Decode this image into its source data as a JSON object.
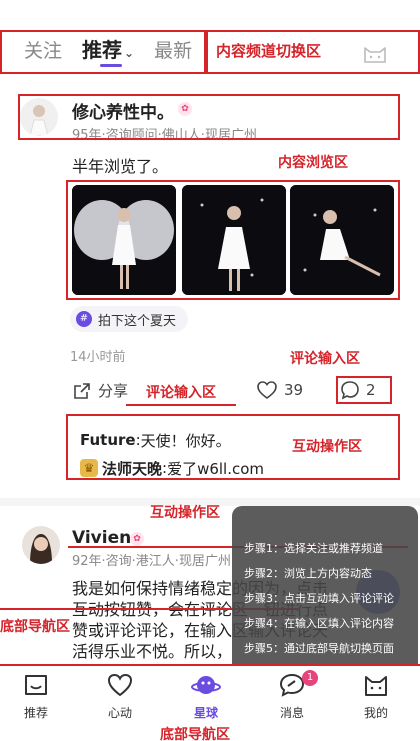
{
  "header": {
    "tabs": [
      {
        "label": "关注"
      },
      {
        "label": "推荐"
      },
      {
        "label": "最新"
      }
    ],
    "active_tab": "推荐"
  },
  "post1": {
    "author": "修心养性中。",
    "meta": "95年·咨询顾问·佛山人·现居广州",
    "text": "半年浏览了。",
    "topic": "拍下这个夏天",
    "time": "14小时前",
    "share_label": "分享",
    "like_count": "39",
    "comment_count": "2",
    "comments": [
      {
        "name": "Future",
        "sep": " : ",
        "text": "天使！你好。"
      },
      {
        "name": "法师天晚",
        "sep": " : ",
        "text": "爱了w6ll.com"
      }
    ]
  },
  "post2": {
    "author": "Vivien",
    "meta": "92年·咨询·港江人·现居广州",
    "text": "我是如何保持情绪稳定的因为，点击互动按钮赞，会在评论区一钮进行点赞或评论评论，在输入区输入评论天活得乐业不悦。所以，"
  },
  "annotations": {
    "channel_switch": "内容频道切换区",
    "content_browse": "内容浏览区",
    "comment_input_1": "评论输入区",
    "comment_input_2": "评论输入区",
    "interaction_1": "互动操作区",
    "interaction_2": "互动操作区",
    "bottom_nav_left": "底部导航区",
    "bottom_nav_bottom": "底部导航区"
  },
  "steps": [
    "步骤1：选择关注或推荐频道",
    "步骤2：浏览上方内容动态",
    "步骤3：点击互动填入评论评论",
    "步骤4：在输入区填入评论内容",
    "步骤5：通过底部导航切换页面"
  ],
  "nav": {
    "items": [
      {
        "label": "推荐",
        "icon": "recommend-icon"
      },
      {
        "label": "心动",
        "icon": "heart-icon"
      },
      {
        "label": "星球",
        "icon": "planet-icon"
      },
      {
        "label": "消息",
        "icon": "message-icon"
      },
      {
        "label": "我的",
        "icon": "profile-icon"
      }
    ],
    "active": "星球",
    "message_badge": "1"
  },
  "colors": {
    "accent": "#6a4ce0",
    "annotation": "#d6242b",
    "badge": "#e5457a"
  }
}
